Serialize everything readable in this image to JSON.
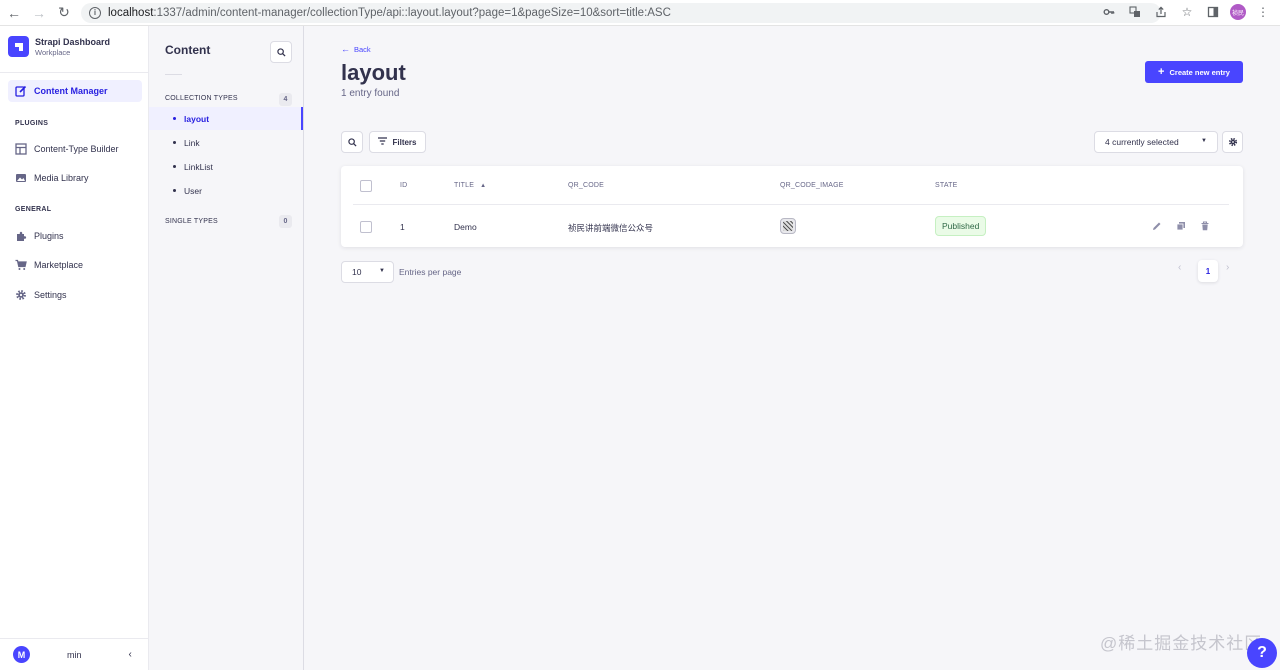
{
  "browser": {
    "url_host": "localhost",
    "url_path": ":1337/admin/content-manager/collectionType/api::layout.layout?page=1&pageSize=10&sort=title:ASC",
    "profile_initials": "祯民"
  },
  "brand": {
    "title": "Strapi Dashboard",
    "subtitle": "Workplace",
    "accent": "#4945ff"
  },
  "main_nav": {
    "content_manager": "Content Manager",
    "plugins_section": "PLUGINS",
    "content_type_builder": "Content-Type Builder",
    "media_library": "Media Library",
    "general_section": "GENERAL",
    "plugins": "Plugins",
    "marketplace": "Marketplace",
    "settings": "Settings",
    "user_initial": "M",
    "username": "min"
  },
  "sub_nav": {
    "title": "Content",
    "collection_types_label": "COLLECTION TYPES",
    "collection_types_count": "4",
    "items": [
      {
        "label": "layout"
      },
      {
        "label": "Link"
      },
      {
        "label": "LinkList"
      },
      {
        "label": "User"
      }
    ],
    "single_types_label": "SINGLE TYPES",
    "single_types_count": "0"
  },
  "header": {
    "back_label": "Back",
    "title": "layout",
    "entry_count": "1 entry found",
    "create_label": "Create new entry"
  },
  "toolbar": {
    "filters_label": "Filters",
    "columns_selected": "4 currently selected"
  },
  "table": {
    "columns": [
      "ID",
      "TITLE",
      "QR_CODE",
      "QR_CODE_IMAGE",
      "STATE"
    ],
    "sort_column": "TITLE",
    "sort_direction": "asc",
    "rows": [
      {
        "id": "1",
        "title": "Demo",
        "qr_code": "祯民讲前端微信公众号",
        "state": "Published"
      }
    ],
    "status_color": "#2f6846"
  },
  "pagination": {
    "page_size": "10",
    "entries_label": "Entries per page",
    "current_page": "1"
  },
  "watermark": "@稀土掘金技术社区",
  "help": "?"
}
